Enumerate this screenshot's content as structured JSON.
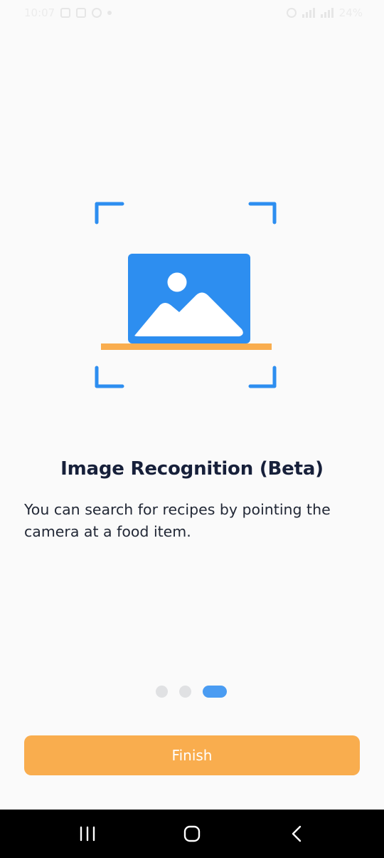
{
  "status_bar": {
    "time": "10:07",
    "battery": "24%"
  },
  "onboarding": {
    "title": "Image Recognition (Beta)",
    "description": "You can search for recipes by pointing the camera at a food item.",
    "pager": {
      "total": 3,
      "active_index": 2
    },
    "finish_label": "Finish"
  },
  "colors": {
    "accent_blue": "#2d8ef0",
    "accent_orange": "#f9ad4e",
    "title_text": "#17203a"
  },
  "icons": {
    "illustration": "image-scan-icon",
    "nav_recent": "recent-apps-icon",
    "nav_home": "home-icon",
    "nav_back": "back-icon"
  }
}
